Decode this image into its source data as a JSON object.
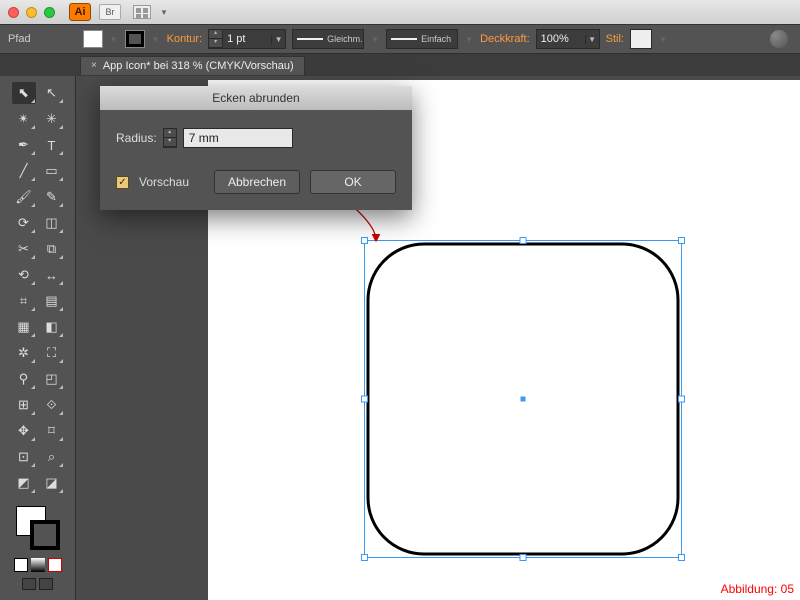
{
  "titlebar": {
    "ai_badge": "Ai",
    "br_badge": "Br"
  },
  "ctrlbar": {
    "path_label": "Pfad",
    "kontur_label": "Kontur:",
    "stroke_weight": "1 pt",
    "dash_label": "Gleichm.",
    "profile_label": "Einfach",
    "deckkraft_label": "Deckkraft:",
    "opacity_value": "100%",
    "stil_label": "Stil:"
  },
  "tab": {
    "close": "×",
    "title": "App Icon* bei 318 % (CMYK/Vorschau)"
  },
  "tools": {
    "icons": [
      "⬉",
      "↖",
      "✴",
      "✳",
      "✒",
      "T",
      "╱",
      "▭",
      "🖌",
      "✎",
      "⟳",
      "◫",
      "✂",
      "⧉",
      "⟲",
      "↔",
      "⌗",
      "▤",
      "▦",
      "◧",
      "✲",
      "⛶",
      "⚲",
      "◰",
      "⊞",
      "⟐",
      "✥",
      "⌑",
      "⊡",
      "⌕",
      "◩",
      "◪"
    ]
  },
  "dialog": {
    "title": "Ecken abrunden",
    "radius_label": "Radius:",
    "radius_value": "7 mm",
    "vorschau_label": "Vorschau",
    "cancel": "Abbrechen",
    "ok": "OK"
  },
  "annotation": {
    "caption": "Abbildung: 05"
  },
  "colors": {
    "accent": "#ff7b00",
    "selection": "#3a9af5"
  }
}
